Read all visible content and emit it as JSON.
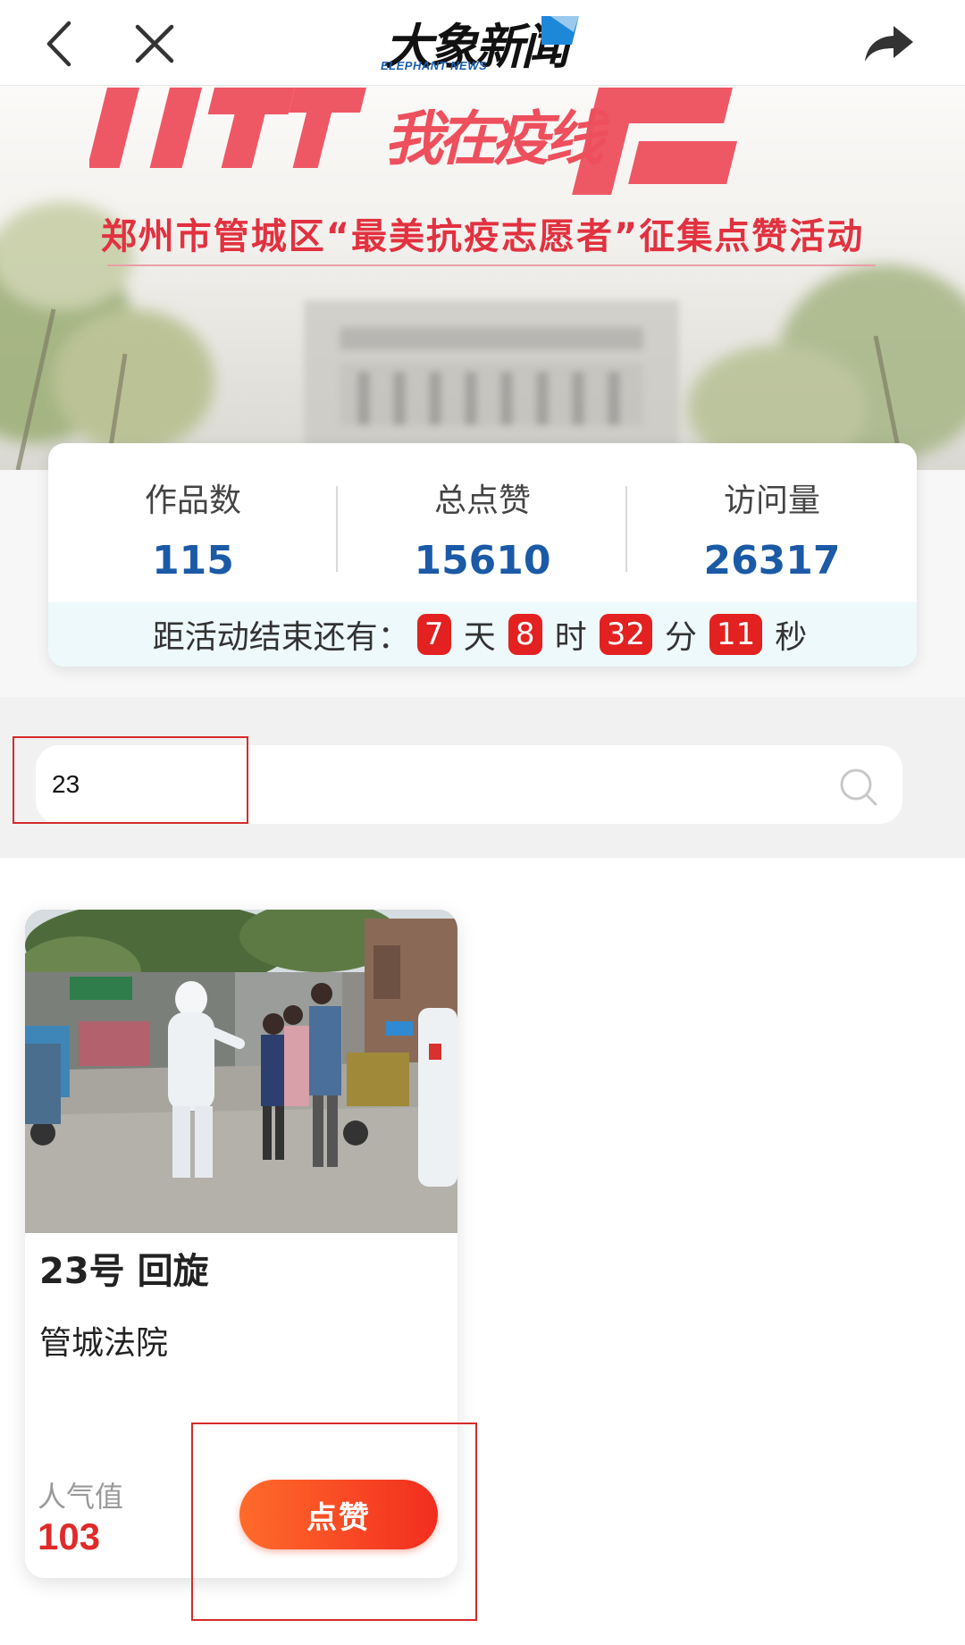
{
  "topbar": {
    "logo_cn": "大象新闻",
    "logo_en": "ELEPHANT NEWS",
    "back_icon": "back-arrow-icon",
    "close_icon": "close-icon",
    "share_icon": "share-icon"
  },
  "banner": {
    "title_partial": "我在疫线",
    "subtitle": "郑州市管城区“最美抗疫志愿者”征集点赞活动"
  },
  "stats": [
    {
      "label": "作品数",
      "value": "115"
    },
    {
      "label": "总点赞",
      "value": "15610"
    },
    {
      "label": "访问量",
      "value": "26317"
    }
  ],
  "countdown": {
    "prefix": "距活动结束还有：",
    "days": "7",
    "days_unit": "天",
    "hours": "8",
    "hours_unit": "时",
    "minutes": "32",
    "minutes_unit": "分",
    "seconds": "11",
    "seconds_unit": "秒"
  },
  "search": {
    "value": "23",
    "icon": "search-icon"
  },
  "results": [
    {
      "title": "23号 回旋",
      "organization": "管城法院",
      "popularity_label": "人气值",
      "popularity_value": "103",
      "like_label": "点赞"
    }
  ],
  "colors": {
    "accent_red": "#e02a2a",
    "stat_blue": "#1b5aa6",
    "banner_pink": "#ee4f5c",
    "like_gradient_start": "#ff6b2a",
    "like_gradient_end": "#f22d1f",
    "highlight_box": "#d62b2b"
  }
}
